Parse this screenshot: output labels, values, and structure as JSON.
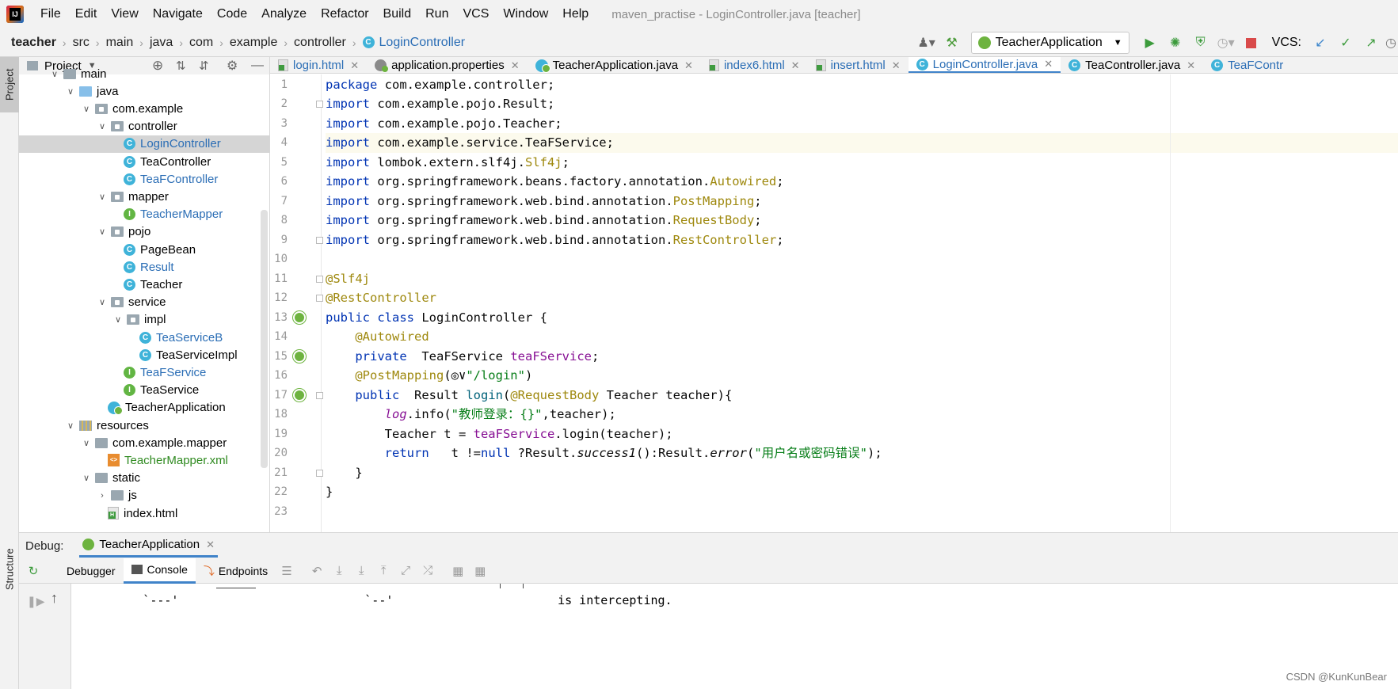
{
  "menubar": {
    "items": [
      "File",
      "Edit",
      "View",
      "Navigate",
      "Code",
      "Analyze",
      "Refactor",
      "Build",
      "Run",
      "VCS",
      "Window",
      "Help"
    ],
    "window_title": "maven_practise - LoginController.java [teacher]"
  },
  "navbar": {
    "crumbs": [
      "teacher",
      "src",
      "main",
      "java",
      "com",
      "example",
      "controller",
      "LoginController"
    ],
    "run_config": "TeacherApplication",
    "vcs_label": "VCS:"
  },
  "left_strip": {
    "project": "Project",
    "structure": "Structure"
  },
  "project_panel": {
    "title": "Project",
    "tree": [
      {
        "label": "main",
        "depth": 2,
        "kind": "folder",
        "expanded": true
      },
      {
        "label": "java",
        "depth": 3,
        "kind": "folder-blue",
        "expanded": true
      },
      {
        "label": "com.example",
        "depth": 4,
        "kind": "package",
        "expanded": true
      },
      {
        "label": "controller",
        "depth": 5,
        "kind": "package",
        "expanded": true
      },
      {
        "label": "LoginController",
        "depth": 6,
        "kind": "class",
        "color": "blue",
        "selected": true
      },
      {
        "label": "TeaController",
        "depth": 6,
        "kind": "class"
      },
      {
        "label": "TeaFController",
        "depth": 6,
        "kind": "class",
        "color": "blue"
      },
      {
        "label": "mapper",
        "depth": 5,
        "kind": "package",
        "expanded": true
      },
      {
        "label": "TeacherMapper",
        "depth": 6,
        "kind": "interface",
        "color": "blue"
      },
      {
        "label": "pojo",
        "depth": 5,
        "kind": "package",
        "expanded": true
      },
      {
        "label": "PageBean",
        "depth": 6,
        "kind": "class"
      },
      {
        "label": "Result",
        "depth": 6,
        "kind": "class",
        "color": "blue"
      },
      {
        "label": "Teacher",
        "depth": 6,
        "kind": "class"
      },
      {
        "label": "service",
        "depth": 5,
        "kind": "package",
        "expanded": true
      },
      {
        "label": "impl",
        "depth": 6,
        "kind": "package",
        "expanded": true
      },
      {
        "label": "TeaServiceB",
        "depth": 7,
        "kind": "class",
        "color": "blue"
      },
      {
        "label": "TeaServiceImpl",
        "depth": 7,
        "kind": "class"
      },
      {
        "label": "TeaFService",
        "depth": 6,
        "kind": "interface",
        "color": "blue"
      },
      {
        "label": "TeaService",
        "depth": 6,
        "kind": "interface"
      },
      {
        "label": "TeacherApplication",
        "depth": 5,
        "kind": "app"
      },
      {
        "label": "resources",
        "depth": 3,
        "kind": "resources",
        "expanded": true
      },
      {
        "label": "com.example.mapper",
        "depth": 4,
        "kind": "folder",
        "expanded": true
      },
      {
        "label": "TeacherMapper.xml",
        "depth": 5,
        "kind": "xml",
        "color": "green"
      },
      {
        "label": "static",
        "depth": 4,
        "kind": "folder",
        "expanded": true
      },
      {
        "label": "js",
        "depth": 5,
        "kind": "folder",
        "expanded": false
      },
      {
        "label": "index.html",
        "depth": 5,
        "kind": "html"
      }
    ]
  },
  "editor_tabs": [
    {
      "label": "login.html",
      "icon": "html-file-icon",
      "color": "#2a6db5"
    },
    {
      "label": "application.properties",
      "icon": "properties-file-icon"
    },
    {
      "label": "TeacherApplication.java",
      "icon": "spring-app-icon"
    },
    {
      "label": "index6.html",
      "icon": "html-file-icon",
      "color": "#2a6db5"
    },
    {
      "label": "insert.html",
      "icon": "html-file-icon",
      "color": "#2a6db5"
    },
    {
      "label": "LoginController.java",
      "icon": "java-class-icon",
      "color": "#2a6db5",
      "active": true
    },
    {
      "label": "TeaController.java",
      "icon": "java-class-icon"
    },
    {
      "label": "TeaFContr",
      "icon": "java-class-icon",
      "color": "#2a6db5"
    }
  ],
  "editor": {
    "current_line": 4,
    "lines": [
      [
        [
          "kw",
          "package"
        ],
        [
          "",
          "com.example.controller;"
        ]
      ],
      [
        [
          "kw",
          "import"
        ],
        [
          "",
          "com.example.pojo.Result;"
        ]
      ],
      [
        [
          "kw",
          "import"
        ],
        [
          "",
          "com.example.pojo.Teacher;"
        ]
      ],
      [
        [
          "kw",
          "import"
        ],
        [
          "",
          "com.example.service.TeaFService;"
        ]
      ],
      [
        [
          "kw",
          "import"
        ],
        [
          "",
          "lombok.extern.slf4j."
        ],
        [
          "ann",
          "Slf4j"
        ],
        [
          "",
          ";"
        ]
      ],
      [
        [
          "kw",
          "import"
        ],
        [
          "",
          "org.springframework.beans.factory.annotation."
        ],
        [
          "ann",
          "Autowired"
        ],
        [
          "",
          ";"
        ]
      ],
      [
        [
          "kw",
          "import"
        ],
        [
          "",
          "org.springframework.web.bind.annotation."
        ],
        [
          "ann",
          "PostMapping"
        ],
        [
          "",
          ";"
        ]
      ],
      [
        [
          "kw",
          "import"
        ],
        [
          "",
          "org.springframework.web.bind.annotation."
        ],
        [
          "ann",
          "RequestBody"
        ],
        [
          "",
          ";"
        ]
      ],
      [
        [
          "kw",
          "import"
        ],
        [
          "",
          "org.springframework.web.bind.annotation."
        ],
        [
          "ann",
          "RestController"
        ],
        [
          "",
          ";"
        ]
      ],
      [],
      [
        [
          "ann",
          "@Slf4j"
        ]
      ],
      [
        [
          "ann",
          "@RestController"
        ]
      ],
      [
        [
          "kw",
          "public class"
        ],
        [
          "",
          "LoginController {"
        ]
      ],
      [
        [
          "",
          "    "
        ],
        [
          "ann",
          "@Autowired"
        ]
      ],
      [
        [
          "",
          "    "
        ],
        [
          "kw",
          "private"
        ],
        [
          "",
          " TeaFService "
        ],
        [
          "fld",
          "teaFService"
        ],
        [
          "",
          ";"
        ]
      ],
      [
        [
          "",
          "    "
        ],
        [
          "ann",
          "@PostMapping"
        ],
        [
          "",
          "(◎∨"
        ],
        [
          "str",
          "\"/login\""
        ],
        [
          "",
          ")"
        ]
      ],
      [
        [
          "",
          "    "
        ],
        [
          "kw",
          "public"
        ],
        [
          "",
          " Result "
        ],
        [
          "fn",
          "login"
        ],
        [
          "",
          "("
        ],
        [
          "ann",
          "@RequestBody"
        ],
        [
          "",
          " Teacher teacher){"
        ]
      ],
      [
        [
          "",
          "        "
        ],
        [
          "fld-itl",
          "log"
        ],
        [
          "",
          ".info("
        ],
        [
          "str",
          "\"教师登录：{}\""
        ],
        [
          "",
          ",teacher);"
        ]
      ],
      [
        [
          "",
          "        Teacher t = "
        ],
        [
          "fld",
          "teaFService"
        ],
        [
          "",
          ".login(teacher);"
        ]
      ],
      [
        [
          "",
          "        "
        ],
        [
          "kw",
          "return"
        ],
        [
          "",
          "  t !="
        ],
        [
          "kw",
          "null"
        ],
        [
          "",
          "?Result."
        ],
        [
          "itl",
          "success1"
        ],
        [
          "",
          "():Result."
        ],
        [
          "itl",
          "error"
        ],
        [
          "",
          "("
        ],
        [
          "str",
          "\"用户名或密码错误\""
        ],
        [
          "",
          ");"
        ]
      ],
      [
        [
          "",
          "    }"
        ]
      ],
      [
        [
          "",
          "}"
        ]
      ],
      []
    ]
  },
  "debug": {
    "label": "Debug:",
    "session_tab": "TeacherApplication",
    "tabs": [
      "Debugger",
      "Console",
      "Endpoints"
    ],
    "console_lines": [
      "          `---'                          `--'                       is intercepting."
    ]
  },
  "watermark": "CSDN @KunKunBear"
}
